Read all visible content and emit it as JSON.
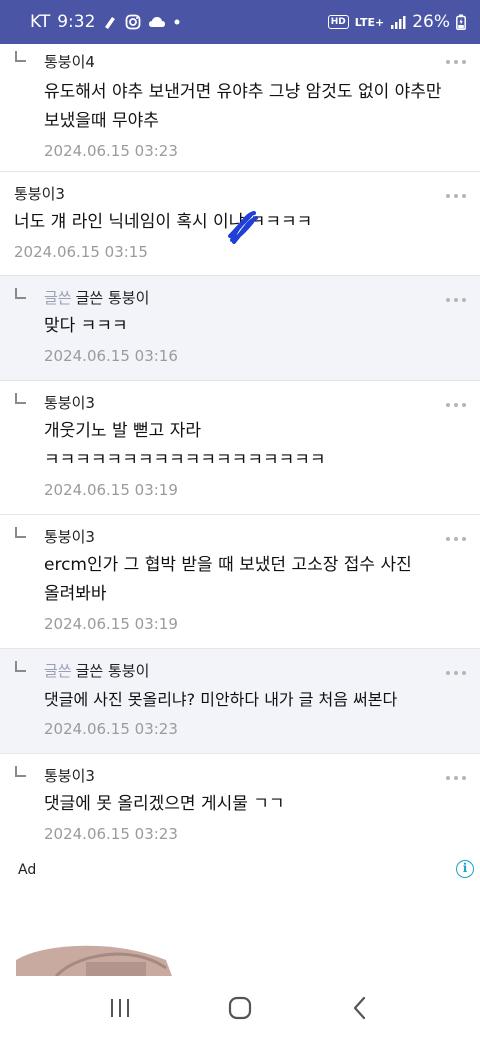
{
  "status_bar": {
    "carrier": "KT",
    "time": "9:32",
    "hd": "HD",
    "network": "LTE+",
    "battery": "26%"
  },
  "comments": [
    {
      "author": "통붕이4",
      "op": false,
      "op_badge": "",
      "text": "유도해서 야추 보낸거면 유야추 그냥 암것도 없이 야추만 보냈을때 무야추",
      "date": "2024.06.15 03:23",
      "reply": true
    },
    {
      "author": "통붕이3",
      "op": false,
      "op_badge": "",
      "text": "너도 걔 라인 닉네임이 혹시 ​​​​​이냐 ㅋㅋㅋㅋ",
      "date": "2024.06.15 03:15",
      "reply": false
    },
    {
      "author": "글쓴 통붕이",
      "op": true,
      "op_badge": "글쓴",
      "text": "맞다 ㅋㅋㅋ",
      "date": "2024.06.15 03:16",
      "reply": true
    },
    {
      "author": "통붕이3",
      "op": false,
      "op_badge": "",
      "text": "개웃기노 발 뻗고 자라 ㅋㅋㅋㅋㅋㅋㅋㅋㅋㅋㅋㅋㅋㅋㅋㅋㅋㅋ",
      "date": "2024.06.15 03:19",
      "reply": true
    },
    {
      "author": "통붕이3",
      "op": false,
      "op_badge": "",
      "text": "ercm인가 그 협박 받을 때 보냈던 고소장 접수 사진 올려봐바",
      "date": "2024.06.15 03:19",
      "reply": true
    },
    {
      "author": "글쓴 통붕이",
      "op": true,
      "op_badge": "글쓴",
      "text": "댓글에 사진 못올리냐? 미안하다 내가 글 처음 써본다",
      "date": "2024.06.15 03:23",
      "reply": true
    },
    {
      "author": "통붕이3",
      "op": false,
      "op_badge": "",
      "text": "댓글에 못 올리겠으면 게시물 ㄱㄱ",
      "date": "2024.06.15 03:23",
      "reply": true
    }
  ],
  "ad": {
    "label": "Ad",
    "info_icon": "i"
  },
  "nav": {
    "recent": "recent-apps-icon",
    "home": "home-icon",
    "back": "back-icon"
  },
  "colors": {
    "status_bar": "#4a55a6",
    "op_row_bg": "#f3f4fa",
    "date": "#9b9b9b",
    "scribble": "#1f3fd6"
  }
}
